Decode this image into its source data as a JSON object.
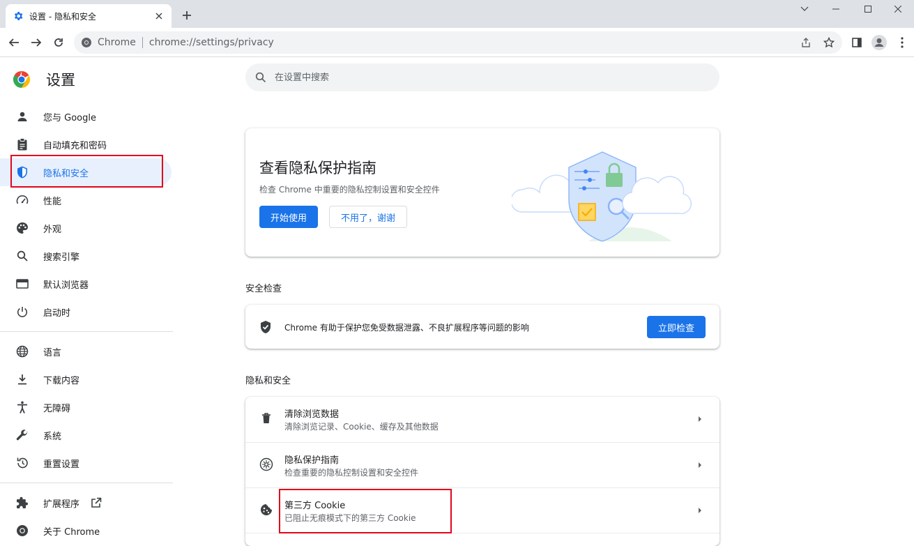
{
  "tab": {
    "title": "设置 - 隐私和安全",
    "icon": "gear-icon"
  },
  "window": {
    "minimize": "minimize-icon",
    "maximize": "maximize-icon",
    "close": "close-icon"
  },
  "omnibox": {
    "site": "Chrome",
    "url": "chrome://settings/privacy"
  },
  "sidebar": {
    "title": "设置",
    "items": [
      {
        "label": "您与 Google",
        "icon": "person-icon"
      },
      {
        "label": "自动填充和密码",
        "icon": "clipboard-icon"
      },
      {
        "label": "隐私和安全",
        "icon": "shield-icon",
        "active": true
      },
      {
        "label": "性能",
        "icon": "speedometer-icon"
      },
      {
        "label": "外观",
        "icon": "palette-icon"
      },
      {
        "label": "搜索引擎",
        "icon": "search-icon"
      },
      {
        "label": "默认浏览器",
        "icon": "browser-icon"
      },
      {
        "label": "启动时",
        "icon": "power-icon"
      },
      {
        "label": "语言",
        "icon": "globe-icon"
      },
      {
        "label": "下载内容",
        "icon": "download-icon"
      },
      {
        "label": "无障碍",
        "icon": "accessibility-icon"
      },
      {
        "label": "系统",
        "icon": "wrench-icon"
      },
      {
        "label": "重置设置",
        "icon": "reset-icon"
      },
      {
        "label": "扩展程序",
        "icon": "puzzle-icon"
      },
      {
        "label": "关于 Chrome",
        "icon": "chrome-icon"
      }
    ]
  },
  "search": {
    "placeholder": "在设置中搜索"
  },
  "guide": {
    "title": "查看隐私保护指南",
    "subtitle": "检查 Chrome 中重要的隐私控制设置和安全控件",
    "start_label": "开始使用",
    "dismiss_label": "不用了，谢谢"
  },
  "safety": {
    "section_title": "安全检查",
    "text": "Chrome 有助于保护您免受数据泄露、不良扩展程序等问题的影响",
    "button_label": "立即检查"
  },
  "privacy": {
    "section_title": "隐私和安全",
    "rows": [
      {
        "title": "清除浏览数据",
        "subtitle": "清除浏览记录、Cookie、缓存及其他数据",
        "icon": "trash-icon"
      },
      {
        "title": "隐私保护指南",
        "subtitle": "检查重要的隐私控制设置和安全控件",
        "icon": "compass-icon"
      },
      {
        "title": "第三方 Cookie",
        "subtitle": "已阻止无痕模式下的第三方 Cookie",
        "icon": "cookie-icon"
      }
    ]
  },
  "colors": {
    "accent": "#1a73e8",
    "highlight_box": "#e0061b",
    "active_bg": "#e8f0fe"
  }
}
